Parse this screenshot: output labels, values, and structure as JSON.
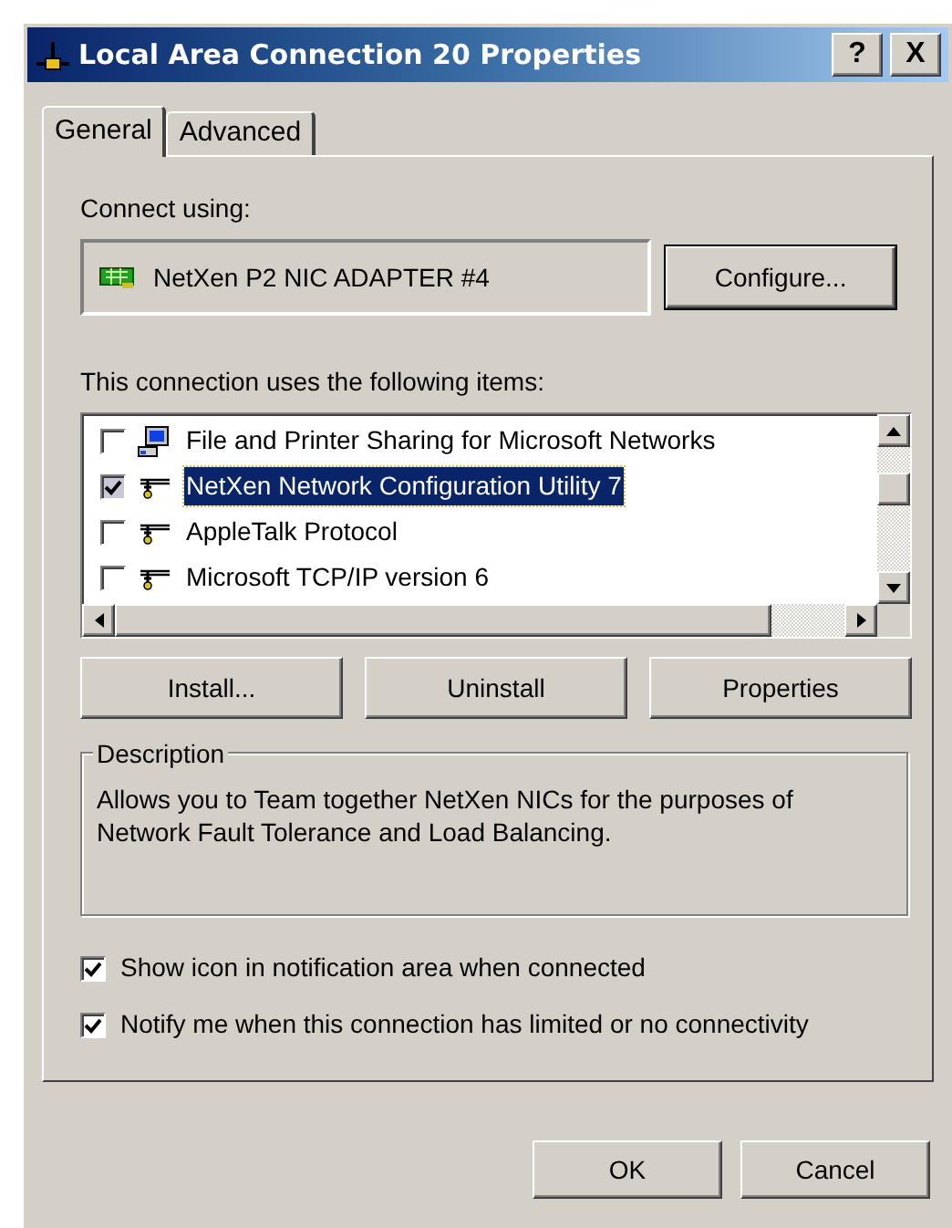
{
  "window": {
    "title": "Local Area Connection 20 Properties",
    "title_buttons": [
      "?",
      "X"
    ]
  },
  "tabs": [
    {
      "label": "General",
      "selected": true
    },
    {
      "label": "Advanced",
      "selected": false
    }
  ],
  "connect_using": {
    "label": "Connect using:",
    "adapter": "NetXen P2 NIC ADAPTER #4",
    "configure_button": "Configure..."
  },
  "items_label": "This connection uses the following items:",
  "items": [
    {
      "label": "File and Printer Sharing for Microsoft Networks",
      "checked": false,
      "selected": false,
      "kind": "service"
    },
    {
      "label": "NetXen Network Configuration Utility 7",
      "checked": true,
      "selected": true,
      "kind": "protocol"
    },
    {
      "label": "AppleTalk Protocol",
      "checked": false,
      "selected": false,
      "kind": "protocol"
    },
    {
      "label": "Microsoft TCP/IP version 6",
      "checked": false,
      "selected": false,
      "kind": "protocol"
    }
  ],
  "item_buttons": [
    "Install...",
    "Uninstall",
    "Properties"
  ],
  "description": {
    "title": "Description",
    "text": "Allows you to Team together NetXen NICs for the purposes of Network Fault Tolerance and Load Balancing."
  },
  "options": [
    {
      "label": "Show icon in notification area when connected",
      "checked": true
    },
    {
      "label": "Notify me when this connection has limited or no connectivity",
      "checked": true
    }
  ],
  "buttons": [
    "OK",
    "Cancel"
  ]
}
